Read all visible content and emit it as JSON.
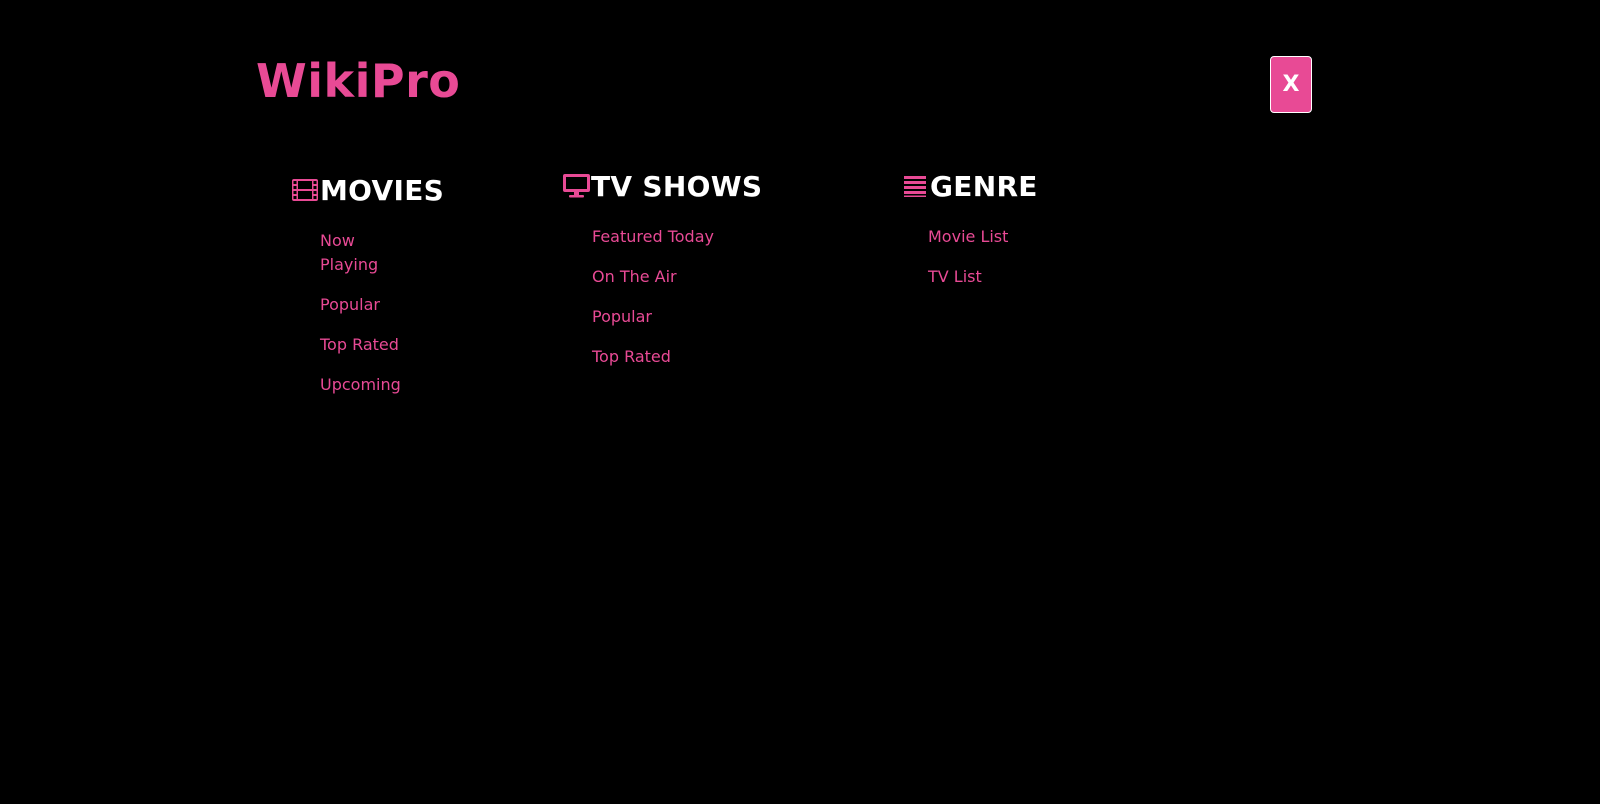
{
  "brand": {
    "name": "WikiPro",
    "color": "#e84a95"
  },
  "close_button": {
    "label": "X"
  },
  "menu": {
    "movies": {
      "title": "MOVIES",
      "icon": "film-icon",
      "items": [
        "Now Playing",
        "Popular",
        "Top Rated",
        "Upcoming"
      ]
    },
    "tv": {
      "title": "TV SHOWS",
      "icon": "tv-icon",
      "items": [
        "Featured Today",
        "On The Air",
        "Popular",
        "Top Rated"
      ]
    },
    "genre": {
      "title": "GENRE",
      "icon": "list-icon",
      "items": [
        "Movie List",
        "TV List"
      ]
    }
  },
  "colors": {
    "background": "#000000",
    "accent": "#e84a95",
    "heading": "#ffffff"
  }
}
